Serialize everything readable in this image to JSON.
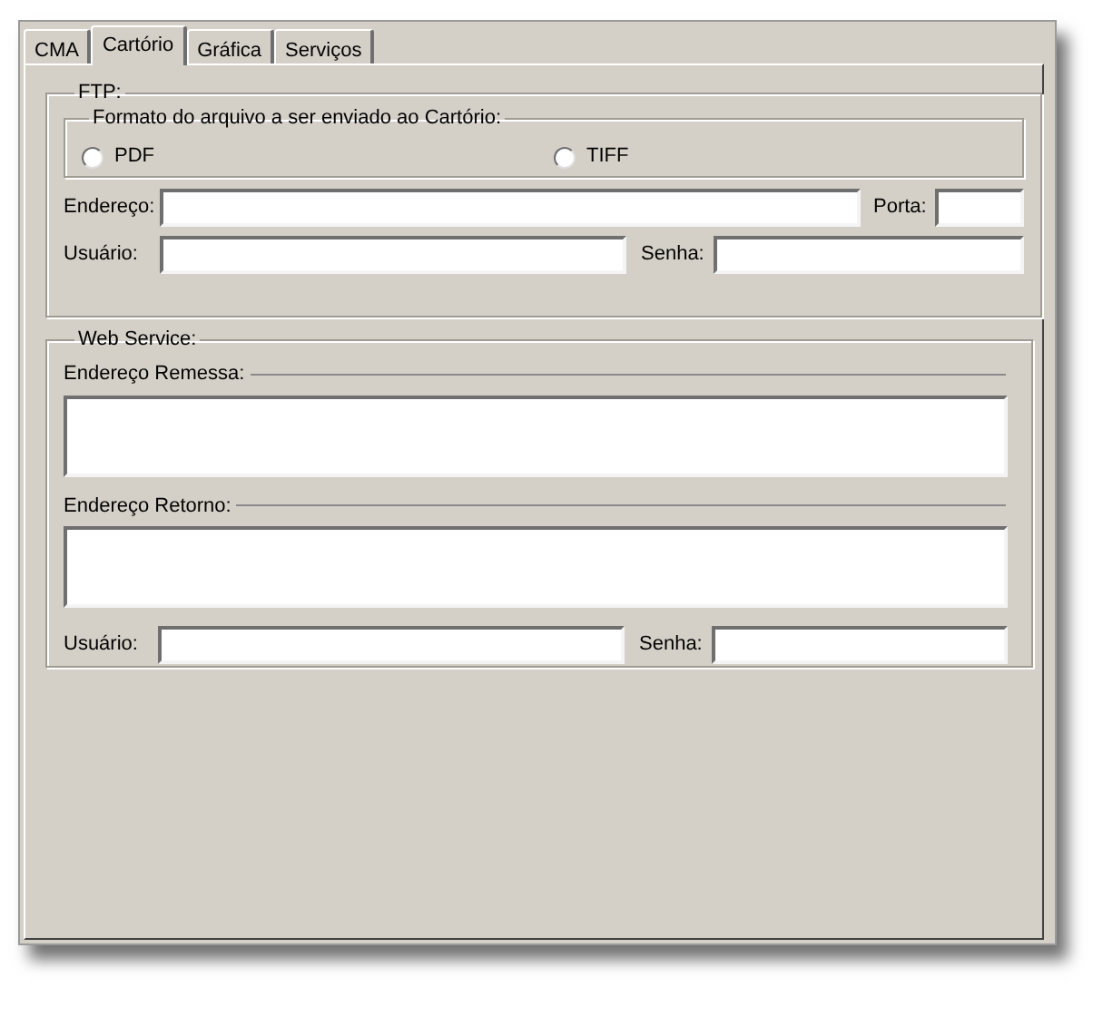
{
  "tabs": [
    {
      "label": "CMA",
      "selected": false
    },
    {
      "label": "Cartório",
      "selected": true
    },
    {
      "label": "Gráfica",
      "selected": false
    },
    {
      "label": "Serviços",
      "selected": false
    }
  ],
  "ftp": {
    "title": "FTP:",
    "format": {
      "title": "Formato do arquivo a ser enviado ao Cartório:",
      "options": [
        {
          "label": "PDF",
          "selected": false
        },
        {
          "label": "TIFF",
          "selected": false
        }
      ]
    },
    "address_label": "Endereço:",
    "port_label": "Porta:",
    "user_label": "Usuário:",
    "password_label": "Senha:"
  },
  "web_service": {
    "title": "Web Service:",
    "send_address_label": "Endereço Remessa:",
    "return_address_label": "Endereço Retorno:",
    "user_label": "Usuário:",
    "password_label": "Senha:"
  }
}
